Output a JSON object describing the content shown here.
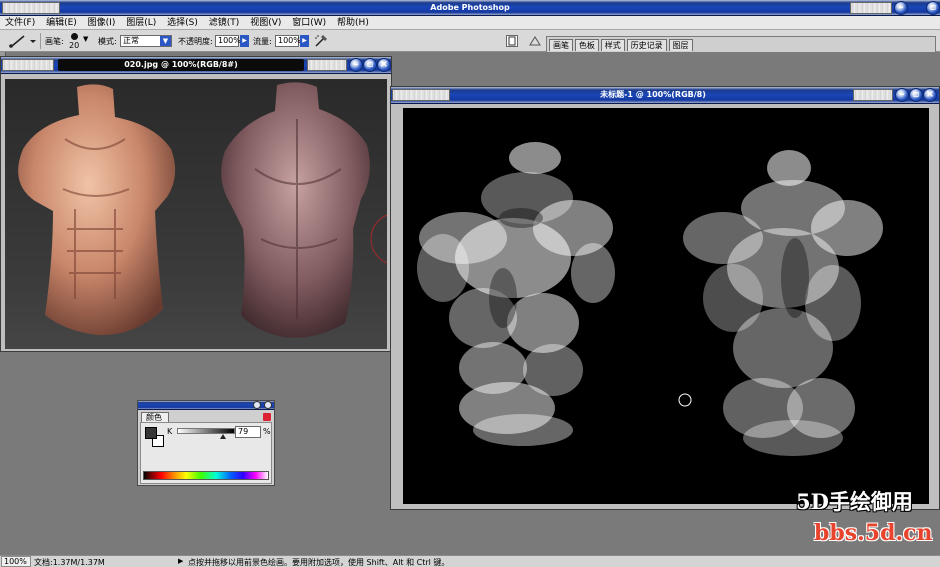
{
  "app": {
    "title": "Adobe Photoshop"
  },
  "menu": {
    "items": [
      "文件(F)",
      "编辑(E)",
      "图像(I)",
      "图层(L)",
      "选择(S)",
      "滤镜(T)",
      "视图(V)",
      "窗口(W)",
      "帮助(H)"
    ]
  },
  "options": {
    "brush_label": "画笔:",
    "brush_size": "20",
    "mode_label": "模式:",
    "mode_value": "正常",
    "opacity_label": "不透明度:",
    "opacity_value": "100%",
    "flow_label": "流量:",
    "flow_value": "100%"
  },
  "palette_well": {
    "tabs": [
      "画笔",
      "色板",
      "样式",
      "历史记录",
      "图层"
    ]
  },
  "reference_doc": {
    "title": "020.jpg @ 100%(RGB/8#)",
    "banner_text": "..."
  },
  "canvas_doc": {
    "title": "未标题-1 @ 100%(RGB/8)"
  },
  "color_panel": {
    "tab_label": "颜色",
    "channel_label": "K",
    "value": "79",
    "unit": "%",
    "slider_fraction": 0.79
  },
  "status": {
    "zoom": "100%",
    "doc_size": "文档:1.37M/1.37M",
    "hint": "点按并拖移以用前景色绘画。要用附加选项，使用 Shift、Alt 和 Ctrl 键。"
  },
  "watermark": {
    "line1": "5D手绘御用",
    "line2": "bbs.5d.cn"
  },
  "colors": {
    "accent": "#1a46b8",
    "workspace": "#7a7a7a"
  }
}
